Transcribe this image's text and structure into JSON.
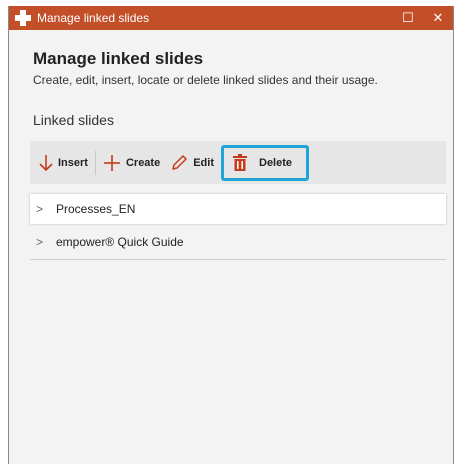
{
  "window": {
    "title": "Manage linked slides",
    "maximize_glyph": "☐",
    "close_glyph": "✕",
    "titlebar_color": "#c24f28"
  },
  "main": {
    "heading": "Manage linked slides",
    "subtitle": "Create, edit, insert, locate or delete linked slides and their usage.",
    "section_label": "Linked slides"
  },
  "toolbar": {
    "insert_label": "Insert",
    "create_label": "Create",
    "edit_label": "Edit",
    "delete_label": "Delete",
    "icons": [
      "arrow-down-icon",
      "plus-icon",
      "pencil-icon",
      "trash-icon"
    ],
    "icon_color": "#c43b1b",
    "highlight_color": "#1fa6d6"
  },
  "linked_slides": [
    {
      "name": "Processes_EN",
      "selected": true
    },
    {
      "name": "empower® Quick Guide",
      "selected": false
    }
  ]
}
